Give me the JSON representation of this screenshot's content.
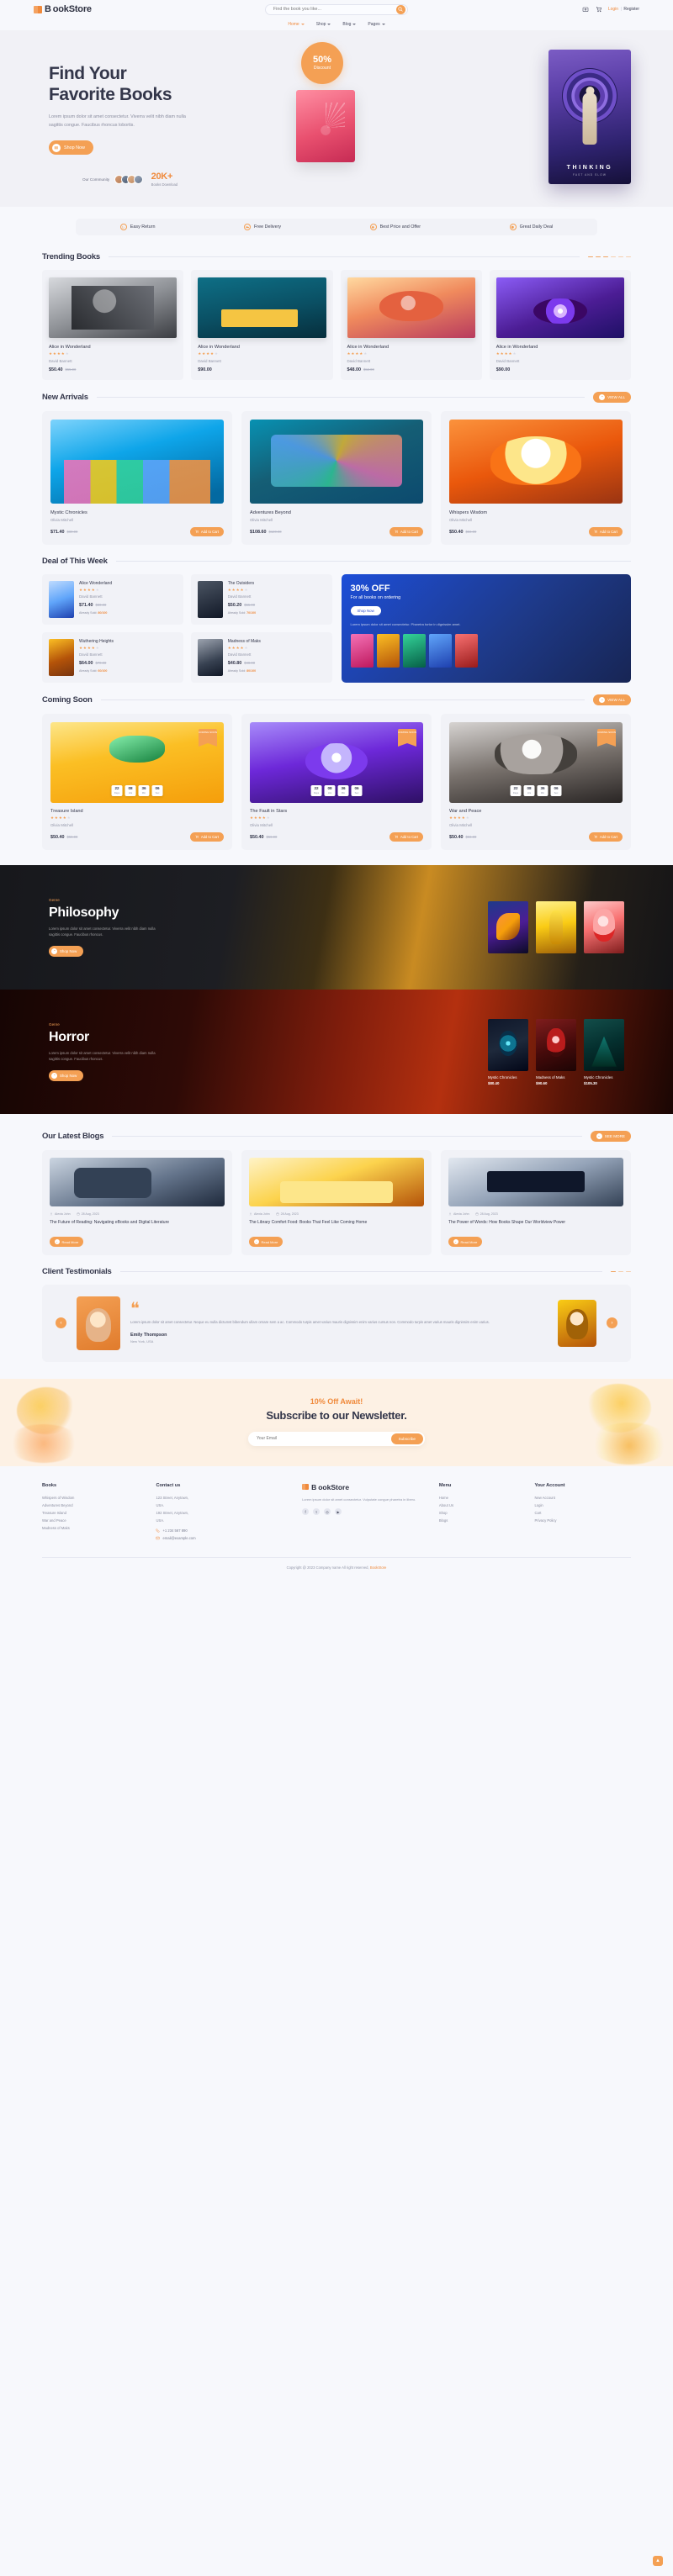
{
  "header": {
    "brand": "ookStore",
    "brand_prefix": "B",
    "search_placeholder": "Find the book you like...",
    "login": "Login",
    "separator": "|",
    "register": "Register",
    "icons": {
      "wishlist": "wishlist-icon",
      "cart": "cart-icon",
      "search": "search-icon"
    }
  },
  "nav": {
    "items": [
      {
        "label": "Home",
        "active": true
      },
      {
        "label": "Shop",
        "active": false
      },
      {
        "label": "Blog",
        "active": false
      },
      {
        "label": "Pages",
        "active": false
      }
    ]
  },
  "hero": {
    "title_line1": "Find Your",
    "title_line2": "Favorite Books",
    "subtitle": "Lorem ipsum dolor sit amet consectetur. Viverra velit nibh diam nulla sagittis congue. Faucibus rhoncus lobortis.",
    "cta": "Shop Now",
    "community_label": "Our Community",
    "stat_number": "20K+",
    "stat_label": "Books Download",
    "discount_percent": "50%",
    "discount_label": "Discount",
    "big_book_title": "THINKING",
    "big_book_sub": "FAST AND SLOW"
  },
  "features": [
    {
      "label": "Easy Return",
      "icon": "return-icon"
    },
    {
      "label": "Free Delivery",
      "icon": "truck-icon"
    },
    {
      "label": "Best Price and Offer",
      "icon": "tag-icon"
    },
    {
      "label": "Great Daily Deal",
      "icon": "deal-icon"
    }
  ],
  "trending": {
    "title": "Trending Books",
    "items": [
      {
        "name": "Alice in Wonderland",
        "author": "David Bannett",
        "price": "$50.40",
        "old_price": "$55.00",
        "rating": 4,
        "cover": "cv1"
      },
      {
        "name": "Alice in Wonderland",
        "author": "David Bannett",
        "price": "$90.00",
        "old_price": "",
        "rating": 4,
        "cover": "cv2"
      },
      {
        "name": "Alice in Wonderland",
        "author": "David Bannett",
        "price": "$48.00",
        "old_price": "$52.00",
        "rating": 4,
        "cover": "cv3"
      },
      {
        "name": "Alice in Wonderland",
        "author": "David Bannett",
        "price": "$90.00",
        "old_price": "",
        "rating": 4,
        "cover": "cv4"
      }
    ]
  },
  "new_arrivals": {
    "title": "New Arrivals",
    "view_all": "VIEW ALL",
    "items": [
      {
        "name": "Mystic Chronicles",
        "author": "Olivia Mitchell",
        "price": "$71.40",
        "old_price": "$80.00",
        "cart": "Add to Cart",
        "cover": "na1"
      },
      {
        "name": "Adventures Beyond",
        "author": "Olivia Mitchell",
        "price": "$108.60",
        "old_price": "$120.00",
        "cart": "Add to Cart",
        "cover": "na2"
      },
      {
        "name": "Whispers Wisdom",
        "author": "Olivia Mitchell",
        "price": "$50.40",
        "old_price": "$56.00",
        "cart": "Add to Cart",
        "cover": "na3"
      }
    ]
  },
  "deal": {
    "title": "Deal of This Week",
    "items": [
      {
        "name": "Alice Wonderland",
        "author": "David Bannett",
        "price": "$71.40",
        "old_price": "$80.00",
        "already": "Already Sold:",
        "already_value": "80/100",
        "rating": 4,
        "cover": "dth1"
      },
      {
        "name": "The Outsiders",
        "author": "David Bannett",
        "price": "$50.20",
        "old_price": "$55.00",
        "already": "Already Sold:",
        "already_value": "70/100",
        "rating": 4,
        "cover": "dth2"
      },
      {
        "name": "Wuthering Heights",
        "author": "David Bannett",
        "price": "$64.00",
        "old_price": "$70.00",
        "already": "Already Sold:",
        "already_value": "60/100",
        "rating": 4,
        "cover": "dth3"
      },
      {
        "name": "Madness of Maks",
        "author": "David Bannett",
        "price": "$40.80",
        "old_price": "$48.00",
        "already": "Already Sold:",
        "already_value": "80/100",
        "rating": 4,
        "cover": "dth4"
      }
    ],
    "promo": {
      "headline": "30% OFF",
      "subhead": "For all books on ordering",
      "button": "Shop Now",
      "text": "Lorem ipsum dolor sit amet consectetur. Pharetra tortor in dignissim amet."
    }
  },
  "coming_soon": {
    "title": "Coming Soon",
    "view_all": "VIEW ALL",
    "flag": "COMING SOON",
    "items": [
      {
        "name": "Treasure Island",
        "author": "Olivia Mitchell",
        "price": "$50.40",
        "old_price": "$56.00",
        "cart": "Add to Cart",
        "rating": 4,
        "cover": "cs1",
        "countdown": [
          {
            "v": "22",
            "u": "Days"
          },
          {
            "v": "08",
            "u": "Hrs"
          },
          {
            "v": "36",
            "u": "Min"
          },
          {
            "v": "06",
            "u": "Sec"
          }
        ]
      },
      {
        "name": "The Fault in Stars",
        "author": "Olivia Mitchell",
        "price": "$50.40",
        "old_price": "$56.00",
        "cart": "Add to Cart",
        "rating": 4,
        "cover": "cs2",
        "countdown": [
          {
            "v": "22",
            "u": "Days"
          },
          {
            "v": "08",
            "u": "Hrs"
          },
          {
            "v": "36",
            "u": "Min"
          },
          {
            "v": "06",
            "u": "Sec"
          }
        ]
      },
      {
        "name": "War and Peace",
        "author": "Olivia Mitchell",
        "price": "$50.40",
        "old_price": "$56.00",
        "cart": "Add to Cart",
        "rating": 4,
        "cover": "cs3",
        "countdown": [
          {
            "v": "22",
            "u": "Days"
          },
          {
            "v": "08",
            "u": "Hrs"
          },
          {
            "v": "36",
            "u": "Min"
          },
          {
            "v": "06",
            "u": "Sec"
          }
        ]
      }
    ]
  },
  "genres": [
    {
      "label": "Genre",
      "heading": "Philosophy",
      "text": "Lorem ipsum dolor sit amet consectetur. Viverra velit nibh diam nulla sagittis congue. Faucibus rhoncus.",
      "button": "Shop Now",
      "books": [
        {
          "name": "",
          "price": "",
          "cover": "gb1"
        },
        {
          "name": "",
          "price": "",
          "cover": "gb2"
        },
        {
          "name": "",
          "price": "",
          "cover": "gb3"
        }
      ]
    },
    {
      "label": "Genre",
      "heading": "Horror",
      "text": "Lorem ipsum dolor sit amet consectetur. Viverra velit nibh diam nulla sagittis congue. Faucibus rhoncus.",
      "button": "Shop Now",
      "books": [
        {
          "name": "Mystic Chronicles",
          "price": "$80.40",
          "cover": "gh1"
        },
        {
          "name": "Madness of Maks",
          "price": "$90.60",
          "cover": "gh2"
        },
        {
          "name": "Mystic Chronicles",
          "price": "$105.30",
          "cover": "gh3"
        }
      ]
    }
  ],
  "blogs": {
    "title": "Our Latest Blogs",
    "see_more": "SEE MORE",
    "items": [
      {
        "author": "Alexia John",
        "date": "28 Aug, 2023",
        "title": "The Future of Reading: Navigating eBooks and Digital Literature",
        "button": "Read More",
        "cover": "bl1"
      },
      {
        "author": "Alexia John",
        "date": "28 Aug, 2023",
        "title": "The Library Comfort Food: Books That Feel Like Coming Home",
        "button": "Read More",
        "cover": "bl2"
      },
      {
        "author": "Alexia John",
        "date": "28 Aug, 2023",
        "title": "The Power of Words: How Books Shape Our Worldview Power",
        "button": "Read More",
        "cover": "bl3"
      }
    ]
  },
  "testimonials": {
    "title": "Client Testimonials",
    "quote": "Lorem ipsum dolor sit amet consectetur. Neque eu nulla dictumst bibendum ullam ornare sem a ac. Commodo turpis amet varius mauris dignissim enim varius cursus non. Commodo turpis amet varius mauris dignissim enim varius.",
    "name": "Emily Thompson",
    "location": "New York, USA",
    "prev": "‹",
    "next": "›"
  },
  "newsletter": {
    "offer": "10% Off Await!",
    "heading": "Subscribe to our Newsletter.",
    "placeholder": "Your Email",
    "button": "Subscribe"
  },
  "footer": {
    "books": {
      "title": "Books",
      "links": [
        "Whispers of Wisdom",
        "Adventures Beyond",
        "Treasure Island",
        "War and Peace",
        "Madness of Maks"
      ]
    },
    "contact": {
      "title": "Contact us",
      "address_line1": "123 Street, Anytown,",
      "address_line2": "USA.",
      "address_line3": "192 Street, Anytown,",
      "address_line4": "USA.",
      "phone": "+1 234 567 890",
      "email": "email@example.com"
    },
    "brand": "ookStore",
    "brand_prefix": "B",
    "brand_desc": "Lorem ipsum dolor sit amet consectetur. Vulputate congue pharetra in libero.",
    "menu": {
      "title": "Menu",
      "links": [
        "Home",
        "About Us",
        "Shop",
        "Blogs"
      ]
    },
    "account": {
      "title": "Your Account",
      "links": [
        "New Account",
        "Login",
        "Cart",
        "Privacy Policy"
      ]
    },
    "copyright_prefix": "Copyright @ 2023 Company name All right reserved,",
    "copyright_brand": "BookStore"
  }
}
